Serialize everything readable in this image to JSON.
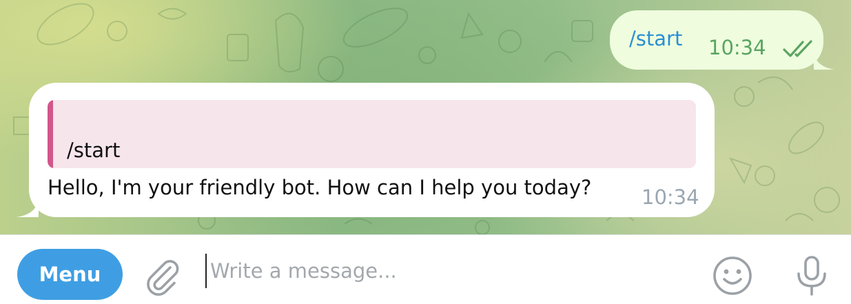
{
  "chat": {
    "outgoing": {
      "text": "/start",
      "time": "10:34",
      "status_icon": "double-check-icon"
    },
    "incoming": {
      "reply_to_text": "/start",
      "text": "Hello, I'm your friendly bot. How can I help you today?",
      "time": "10:34"
    }
  },
  "input_bar": {
    "menu_label": "Menu",
    "placeholder": "Write a message...",
    "attach_icon": "paperclip-icon",
    "emoji_icon": "smiley-icon",
    "mic_icon": "microphone-icon"
  },
  "colors": {
    "accent": "#3f9ee3",
    "outgoing_bubble": "#effdde",
    "reply_bar": "#d2568a",
    "reply_background": "#f7e5ec",
    "outgoing_time": "#5aa463"
  }
}
